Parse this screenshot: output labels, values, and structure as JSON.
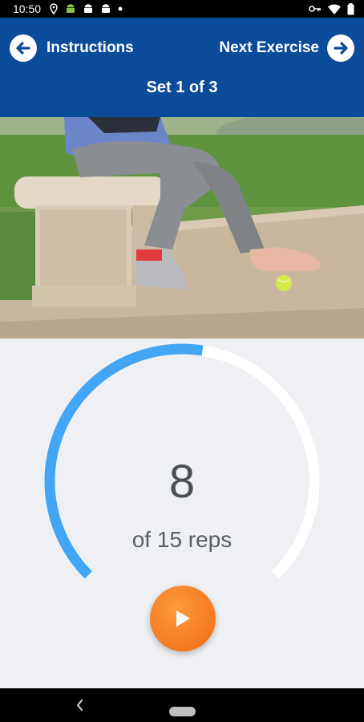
{
  "status_bar": {
    "time": "10:50"
  },
  "header": {
    "back_label": "Instructions",
    "next_label": "Next Exercise",
    "set_label": "Set 1 of 3"
  },
  "progress": {
    "current_reps": "8",
    "total_label": "of 15 reps",
    "fraction": 0.533
  },
  "colors": {
    "header_bg": "#0b4c9a",
    "progress_ring": "#42a5f5",
    "ring_track": "#ffffff",
    "play_button": "#f47a20"
  },
  "icons": {
    "back": "arrow-left-circle-icon",
    "next": "arrow-right-circle-icon",
    "play": "play-icon",
    "nav_back": "chevron-left-icon"
  }
}
